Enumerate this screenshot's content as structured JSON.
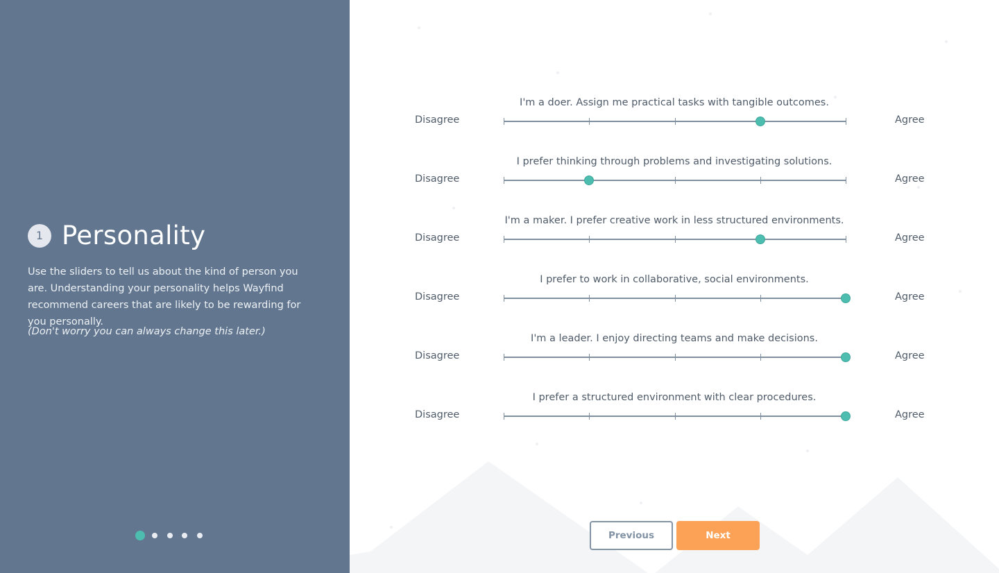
{
  "step": {
    "number": "1",
    "title": "Personality",
    "description": "Use the sliders to tell us about the kind of person you are. Understanding your personality helps Wayfind recommend careers that are likely to be rewarding for you personally.",
    "note": "(Don't worry you can always change this later.)"
  },
  "progress": {
    "steps": 5,
    "current": 1
  },
  "scale": {
    "min_label": "Disagree",
    "max_label": "Agree",
    "positions": 5
  },
  "questions": [
    {
      "text": "I'm a doer. Assign me practical tasks with tangible outcomes.",
      "value": 4
    },
    {
      "text": "I prefer thinking through problems and investigating solutions.",
      "value": 2
    },
    {
      "text": "I'm a maker. I prefer creative work in less structured environments.",
      "value": 4
    },
    {
      "text": "I prefer to work in collaborative, social environments.",
      "value": 5
    },
    {
      "text": "I'm a leader. I enjoy directing teams and make decisions.",
      "value": 5
    },
    {
      "text": "I prefer a structured environment with clear procedures.",
      "value": 5
    }
  ],
  "buttons": {
    "previous": "Previous",
    "next": "Next"
  },
  "colors": {
    "sidebar": "#62778f",
    "accent": "#4dbdb0",
    "next_button": "#fba257"
  }
}
